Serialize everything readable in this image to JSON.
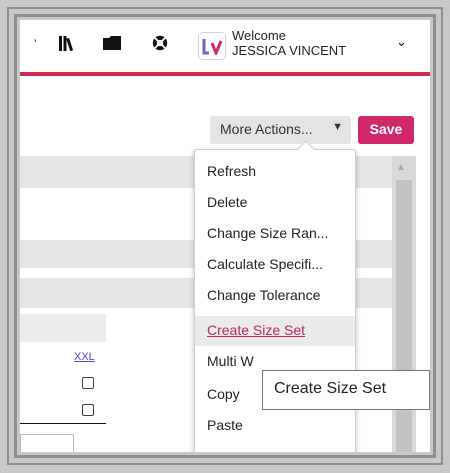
{
  "header": {
    "welcome_label": "Welcome",
    "user_name": "JESSICA VINCENT",
    "logo_letter": "lv",
    "icons": [
      "books-icon",
      "folder-icon",
      "help-lifebuoy-icon",
      "brand-logo",
      "user-menu-chevron-icon"
    ]
  },
  "toolbar": {
    "more_actions_label": "More Actions...",
    "save_label": "Save"
  },
  "table": {
    "column_header": "XXL"
  },
  "menu": {
    "items": [
      {
        "label": "Refresh"
      },
      {
        "label": "Delete"
      },
      {
        "label": "Change Size Ran..."
      },
      {
        "label": "Calculate Specifi..."
      },
      {
        "label": "Change Tolerance"
      },
      {
        "label": "Create Size Set"
      },
      {
        "label": "Multi W"
      },
      {
        "label": "Copy"
      },
      {
        "label": "Paste"
      }
    ],
    "hovered_index": 5
  },
  "tooltip": {
    "text": "Create Size Set"
  },
  "colors": {
    "accent_red": "#d0284e",
    "save_button": "#d0286a",
    "hover_link": "#c0265e"
  }
}
